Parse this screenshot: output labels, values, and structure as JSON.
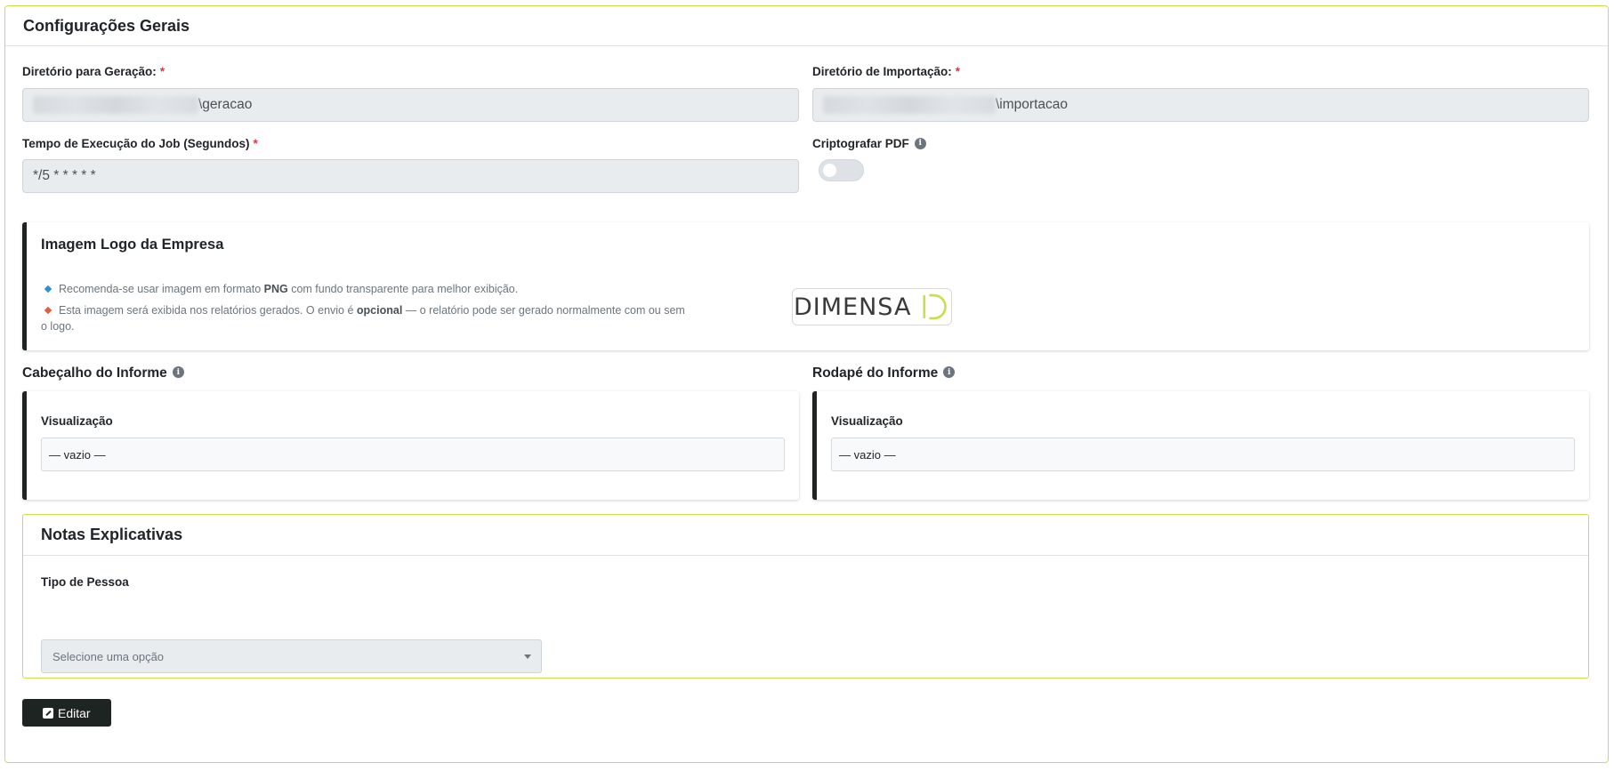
{
  "general": {
    "title": "Configurações Gerais",
    "gen_dir": {
      "label": "Diretório para Geração:",
      "required": "*",
      "suffix": "\\geracao"
    },
    "import_dir": {
      "label": "Diretório de Importação:",
      "required": "*",
      "suffix": "\\importacao"
    },
    "job_time": {
      "label": "Tempo de Execução do Job (Segundos)",
      "required": "*",
      "value": "*/5 * * * * *"
    },
    "encrypt_pdf": {
      "label": "Criptografar PDF",
      "enabled": false
    }
  },
  "logo_panel": {
    "title": "Imagem Logo da Empresa",
    "bullet1": {
      "pre": "Recomenda-se usar imagem em formato ",
      "bold": "PNG",
      "post": " com fundo transparente para melhor exibição.",
      "color": "#2f8fd6"
    },
    "bullet2": {
      "pre": "Esta imagem será exibida nos relatórios gerados. O envio é ",
      "bold": "opcional",
      "post": " — o relatório pode ser gerado normalmente com ou sem o logo.",
      "color": "#e35d3a"
    },
    "logo_text": "DIMENSA"
  },
  "header_section": {
    "label": "Cabeçalho do Informe",
    "viz_label": "Visualização",
    "value": "— vazio —"
  },
  "footer_section": {
    "label": "Rodapé do Informe",
    "viz_label": "Visualização",
    "value": "— vazio —"
  },
  "notes": {
    "title": "Notas Explicativas",
    "person_type": {
      "label": "Tipo de Pessoa",
      "placeholder": "Selecione uma opção"
    }
  },
  "actions": {
    "edit_label": "Editar"
  },
  "colors": {
    "accent_border": "#c5e04a",
    "dark": "#1d2422",
    "required": "#dc3545"
  }
}
